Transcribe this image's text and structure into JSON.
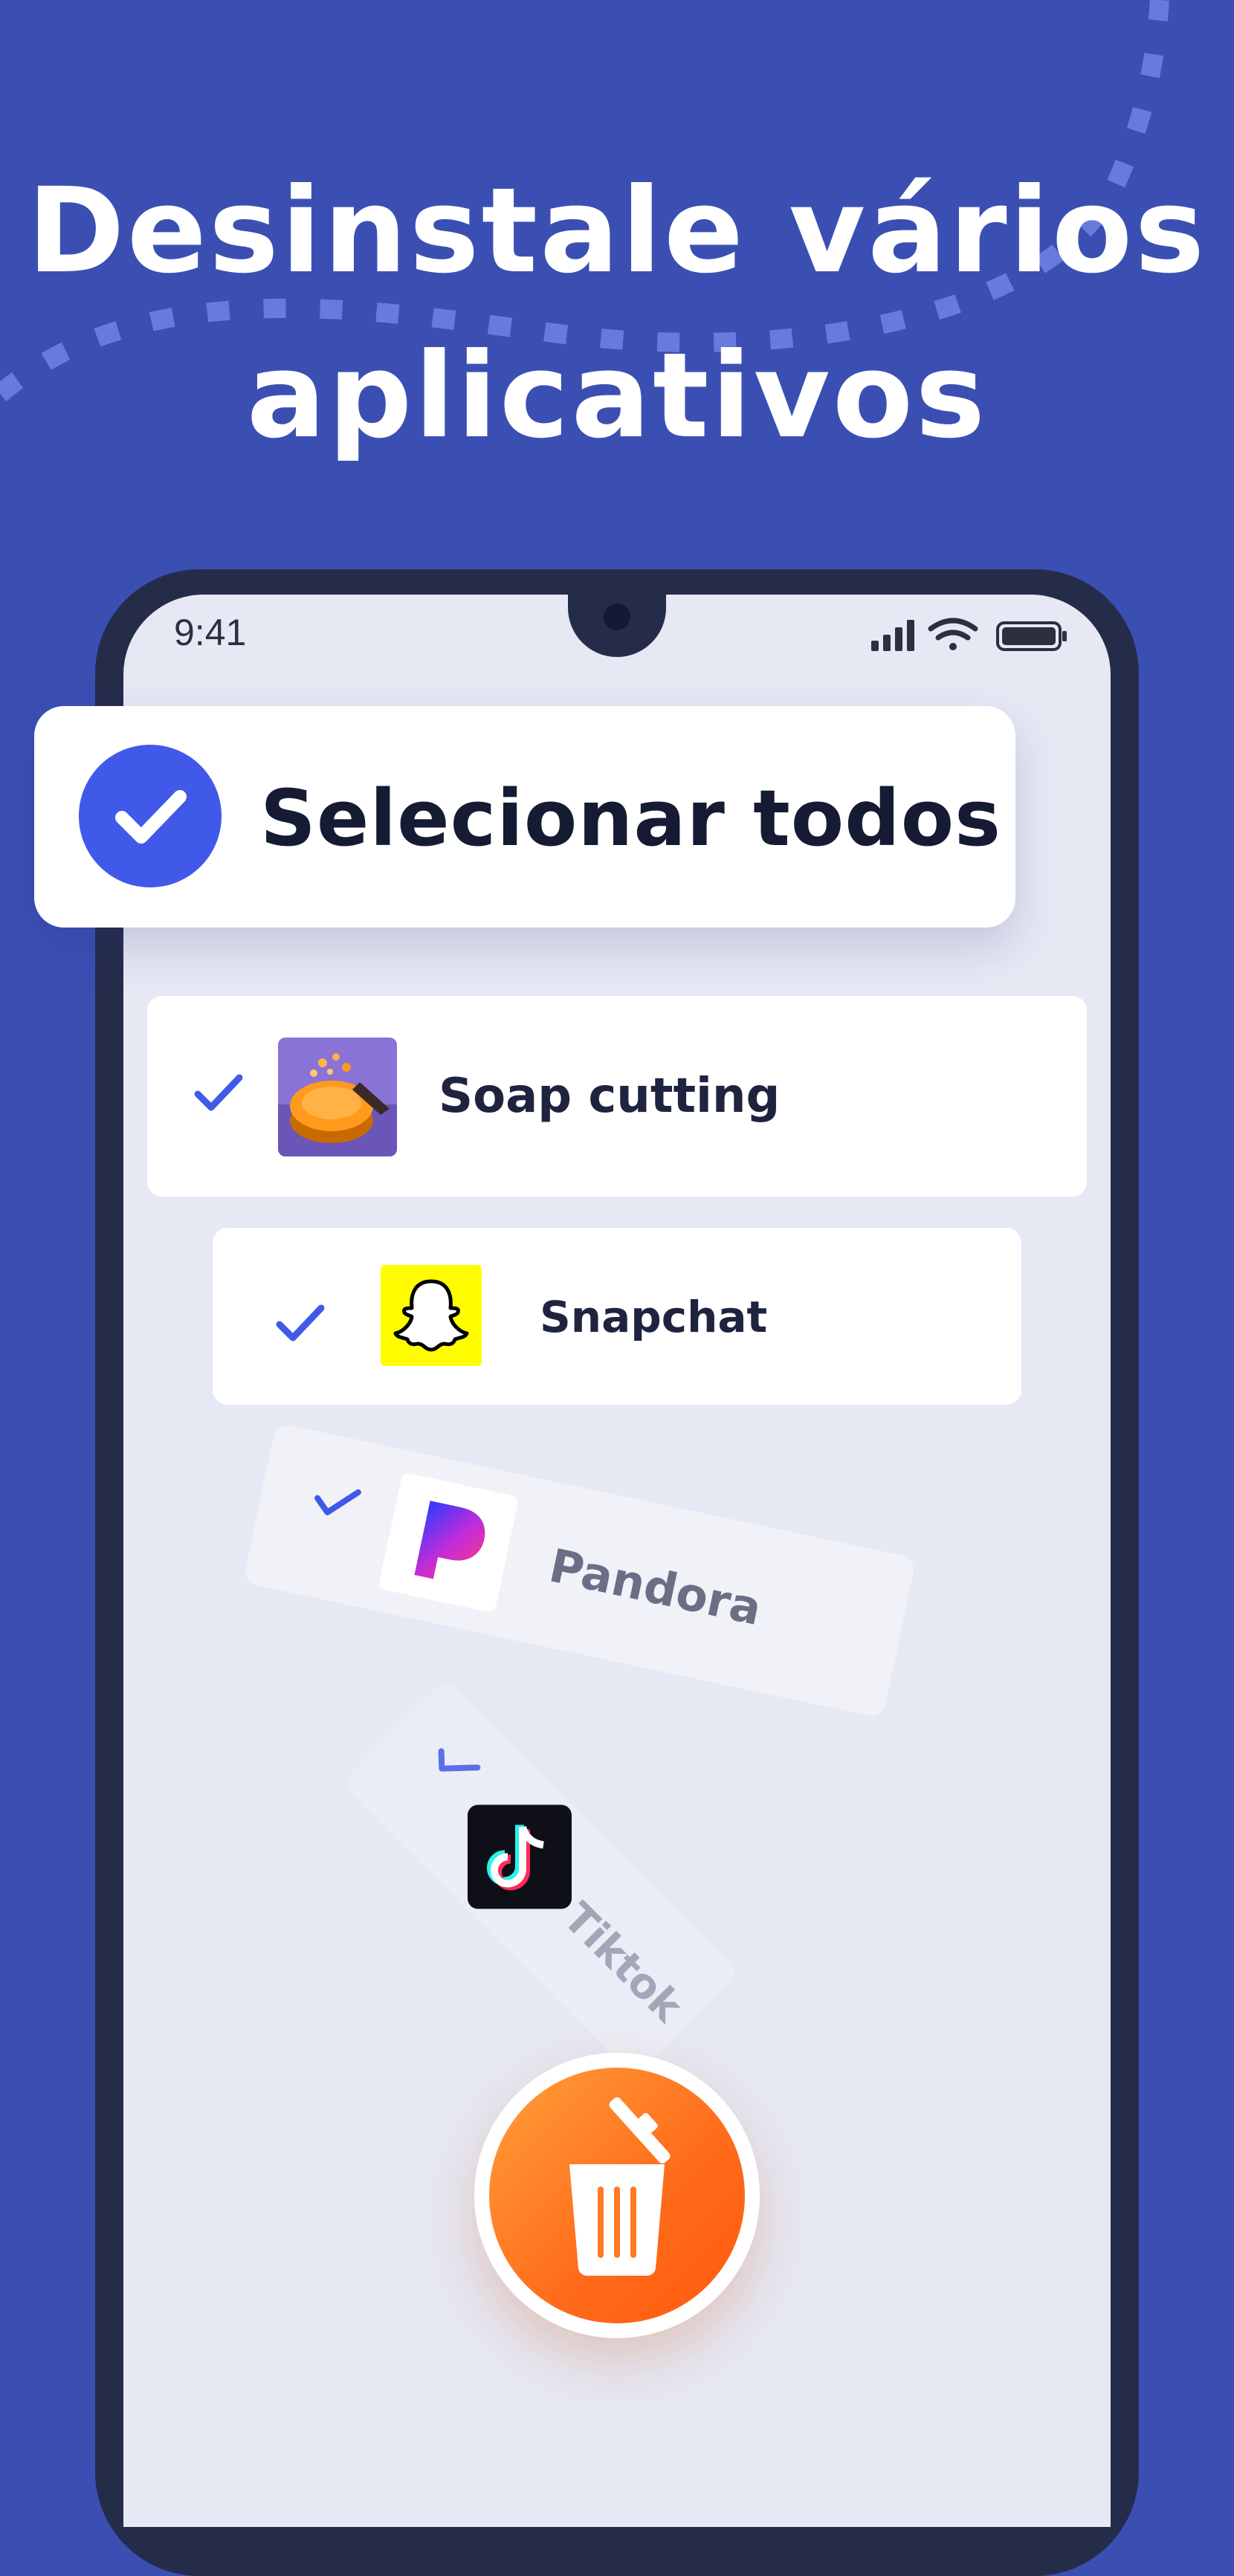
{
  "headline": {
    "line1": "Desinstale vários",
    "line2": "aplicativos"
  },
  "status_bar": {
    "time": "9:41",
    "icons": [
      "signal-icon",
      "wifi-icon",
      "battery-icon"
    ]
  },
  "select_all": {
    "label": "Selecionar todos",
    "checked": true
  },
  "apps": [
    {
      "name": "Soap cutting",
      "checked": true,
      "icon": "soap-cutting-app-icon"
    },
    {
      "name": "Snapchat",
      "checked": true,
      "icon": "snapchat-app-icon"
    },
    {
      "name": "Pandora",
      "checked": true,
      "icon": "pandora-app-icon"
    },
    {
      "name": "Tiktok",
      "checked": true,
      "icon": "tiktok-app-icon"
    }
  ],
  "action": {
    "icon": "trash-icon"
  },
  "colors": {
    "background": "#3b4fb3",
    "accent": "#4159e8",
    "phone_frame": "#252c4a",
    "screen": "#e6e8f4",
    "action_orange": "#ff6a1a"
  }
}
